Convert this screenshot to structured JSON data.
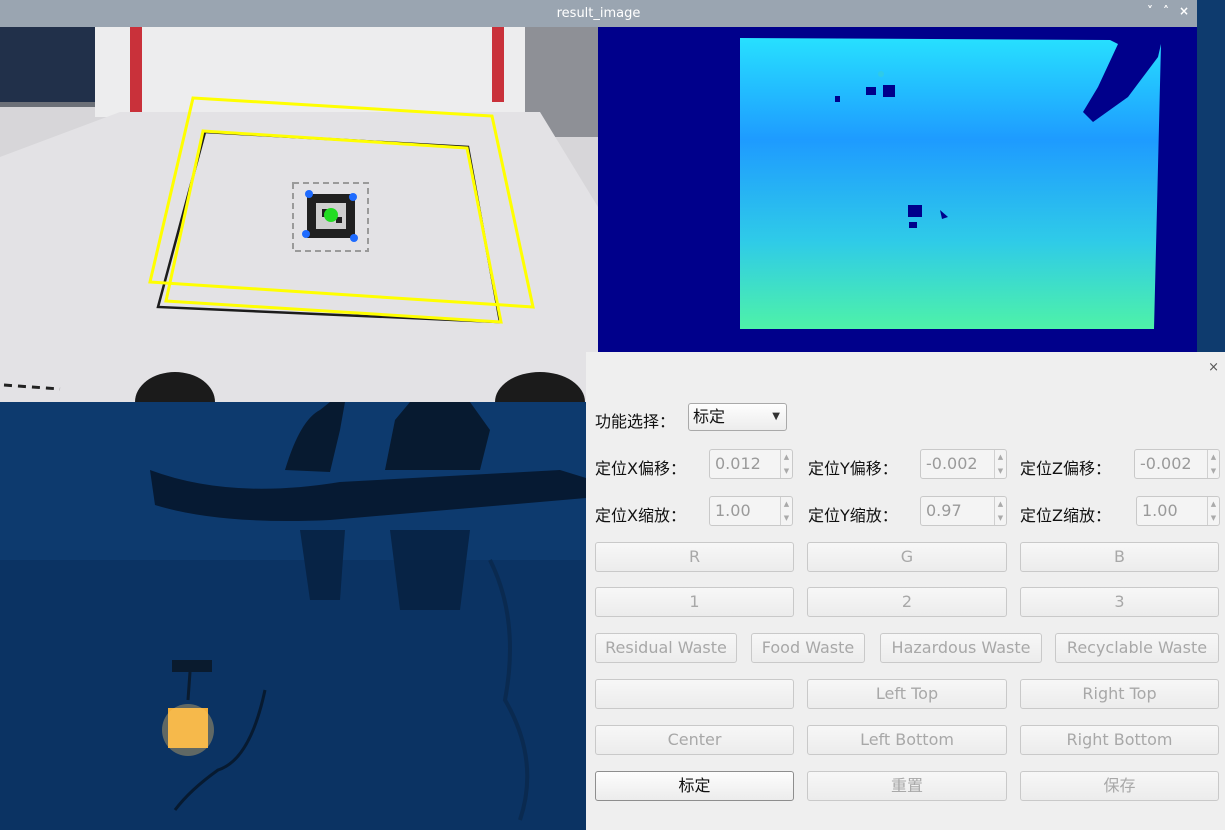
{
  "result_window": {
    "title": "result_image",
    "controls": [
      "˅",
      "˄",
      "×"
    ]
  },
  "control_window": {
    "close_icon": "×",
    "function_select": {
      "label": "功能选择：",
      "value": "标定"
    },
    "offsets": [
      {
        "label": "定位X偏移：",
        "value": "0.012"
      },
      {
        "label": "定位Y偏移：",
        "value": "-0.002"
      },
      {
        "label": "定位Z偏移：",
        "value": "-0.002"
      }
    ],
    "scales": [
      {
        "label": "定位X缩放：",
        "value": "1.00"
      },
      {
        "label": "定位Y缩放：",
        "value": "0.97"
      },
      {
        "label": "定位Z缩放：",
        "value": "1.00"
      }
    ],
    "color_buttons": [
      "R",
      "G",
      "B"
    ],
    "number_buttons": [
      "1",
      "2",
      "3"
    ],
    "waste_buttons": [
      "Residual Waste",
      "Food Waste",
      "Hazardous Waste",
      "Recyclable Waste"
    ],
    "position_buttons_row1": [
      "",
      "Left Top",
      "Right Top"
    ],
    "position_buttons_row2": [
      "Center",
      "Left Bottom",
      "Right Bottom"
    ],
    "action_buttons": [
      "标定",
      "重置",
      "保存"
    ]
  },
  "colors": {
    "titlebar": "#9aa5b1",
    "panel": "#efefef",
    "depth_background": "#00008b",
    "roi_outline": "#ffff00",
    "marker_center": "#22dd22",
    "marker_corner": "#1e6bff"
  },
  "icons": {
    "titlebar_controls": [
      "chevron-down-icon",
      "chevron-up-icon",
      "close-icon"
    ],
    "spin_arrows": [
      "arrow-up-icon",
      "arrow-down-icon"
    ],
    "combo_arrow": "dropdown-arrow-icon"
  }
}
